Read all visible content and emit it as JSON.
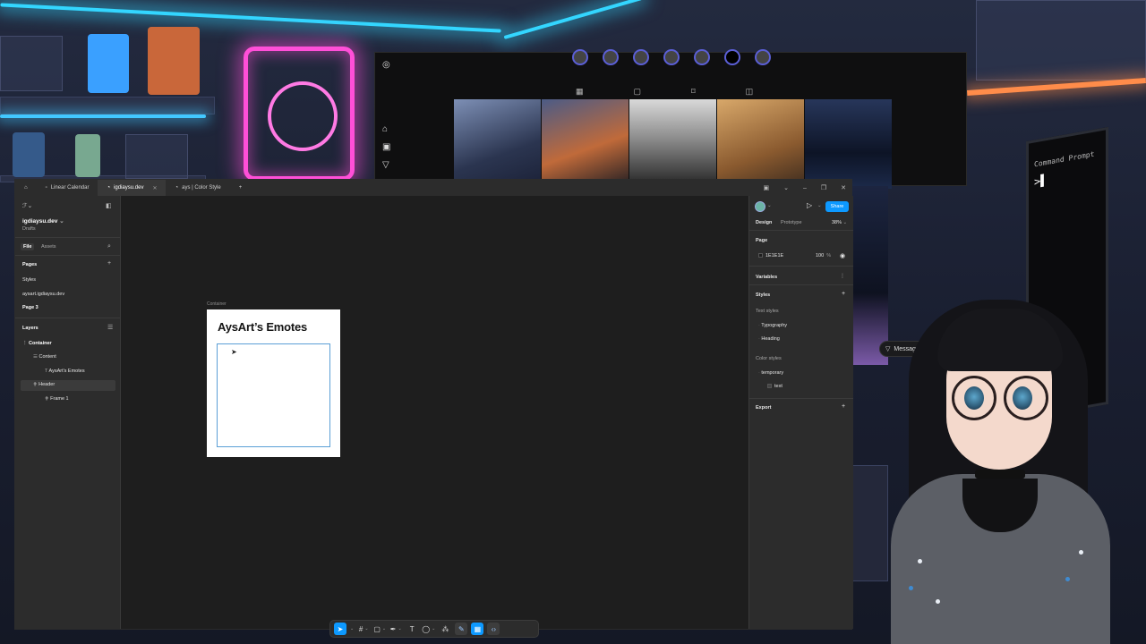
{
  "figma": {
    "tabs": [
      {
        "label": "Linear Calendar"
      },
      {
        "label": "igdiaysu.dev"
      },
      {
        "label": "ays | Color Style"
      }
    ],
    "left_panel": {
      "team": "igdiaysu.dev",
      "drafts": "Drafts",
      "file_tab": "File",
      "assets_tab": "Assets",
      "pages_heading": "Pages",
      "pages": [
        "Styles",
        "aysart.igdiaysu.dev",
        "Page 3"
      ],
      "layers_heading": "Layers",
      "layers": [
        "Container",
        "Content",
        "AysArt's Emotes",
        "Header",
        "Frame 1"
      ]
    },
    "canvas": {
      "frame_label": "Container",
      "frame_title": "AysArt’s Emotes"
    },
    "right_panel": {
      "design_tab": "Design",
      "prototype_tab": "Prototype",
      "zoom": "38%",
      "share": "Share",
      "page_heading": "Page",
      "page_color": "1E1E1E",
      "page_opacity": "100",
      "page_opacity_unit": "%",
      "variables": "Variables",
      "styles": "Styles",
      "text_styles": "Text styles",
      "text_style_items": [
        "Typography",
        "Heading"
      ],
      "color_styles": "Color styles",
      "color_style_items": [
        "temporary",
        "text"
      ],
      "export": "Export"
    },
    "help": "?"
  },
  "overlay": {
    "messages": "Messages",
    "terminal_title": "Command Prompt"
  },
  "colors": {
    "figma_blue": "#0d99ff",
    "canvas_bg": "#1e1e1e",
    "panel_bg": "#2c2c2c",
    "neon_pink": "#ff4fd8",
    "neon_blue": "#33d6ff"
  }
}
